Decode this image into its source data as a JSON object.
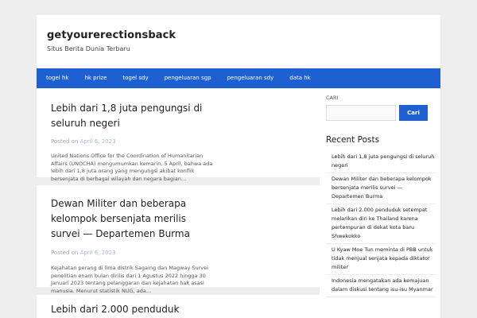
{
  "site": {
    "title": "getyourerectionsback",
    "description": "Situs Berita Dunia Terbaru"
  },
  "nav": {
    "items": [
      {
        "label": "togel hk"
      },
      {
        "label": "hk prize"
      },
      {
        "label": "togel sdy"
      },
      {
        "label": "pengeluaran sgp"
      },
      {
        "label": "pengeluaran sdy"
      },
      {
        "label": "data hk"
      }
    ]
  },
  "posts": [
    {
      "title": "Lebih dari 1,8 juta pengungsi di seluruh negeri",
      "meta_prefix": "Posted on",
      "date": "April 6, 2023",
      "excerpt": "United Nations Office for the Coordination of Humanitarian Affairs (UNOCHA) mengumumkan kemarin, 5 April, bahwa ada lebih dari 1,8 juta orang yang mengungsi akibat konflik bersenjata di berbagai wilayah dan negara bagian…"
    },
    {
      "title": "Dewan Militer dan beberapa kelompok bersenjata merilis survei — Departemen Burma",
      "meta_prefix": "Posted on",
      "date": "April 6, 2023",
      "excerpt": "Kejahatan perang di lima distrik Sagaing dan Magway Survei penelitian enam bulan dirilis dari 1 Agustus 2022 hingga 30 Januari 2023 tentang pelanggaran dan kejahatan hak asasi manusia. Menurut statistik NUG, ada…"
    },
    {
      "title": "Lebih dari 2.000 penduduk",
      "meta_prefix": "",
      "date": "",
      "excerpt": ""
    }
  ],
  "sidebar": {
    "search_label": "CARI",
    "search_placeholder": "",
    "search_button": "Cari",
    "recent_title": "Recent Posts",
    "recent_posts": [
      {
        "label": "Lebih dari 1,8 juta pengungsi di seluruh negeri"
      },
      {
        "label": "Dewan Militer dan beberapa kelompok bersenjata merilis survei — Departemen Burma"
      },
      {
        "label": "Lebih dari 2.000 penduduk setempat melarikan diri ke Thailand karena pertempuran di dekat kota baru Shwekokko"
      },
      {
        "label": "U Kyaw Moe Tun meminta di PBB untuk tidak menjual senjata kepada diktator militer"
      },
      {
        "label": "Indonesia mengatakan ada kemajuan dalam diskusi tentang isu-isu Myanmar"
      }
    ]
  },
  "colors": {
    "accent": "#1e5fd1",
    "background": "#eeeeee",
    "panel": "#ffffff"
  }
}
